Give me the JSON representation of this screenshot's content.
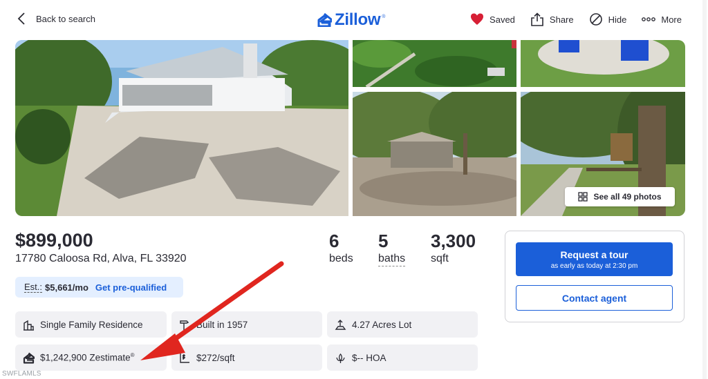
{
  "nav": {
    "back_label": "Back to search",
    "logo_text": "Zillow",
    "logo_mark": "®",
    "saved_label": "Saved",
    "share_label": "Share",
    "hide_label": "Hide",
    "more_label": "More"
  },
  "gallery": {
    "see_all_label": "See all 49 photos"
  },
  "listing": {
    "price": "$899,000",
    "address": "17780 Caloosa Rd, Alva, FL 33920",
    "beds_value": "6",
    "beds_label": "beds",
    "baths_value": "5",
    "baths_label": "baths",
    "sqft_value": "3,300",
    "sqft_label": "sqft"
  },
  "estimate": {
    "label": "Est.:",
    "amount": "$5,661/mo",
    "link": "Get pre-qualified"
  },
  "facts": {
    "type": "Single Family Residence",
    "built": "Built in 1957",
    "lot": "4.27 Acres Lot",
    "zestimate": "$1,242,900 Zestimate",
    "zestimate_mark": "®",
    "price_per_sqft": "$272/sqft",
    "hoa": "$-- HOA"
  },
  "cta": {
    "tour_title": "Request a tour",
    "tour_subtitle": "as early as today at 2:30 pm",
    "contact_label": "Contact agent"
  },
  "watermark": "SWFLAMLS",
  "colors": {
    "brand": "#1b5fd9",
    "heart": "#d71f35",
    "annotation_arrow": "#e0261f"
  }
}
